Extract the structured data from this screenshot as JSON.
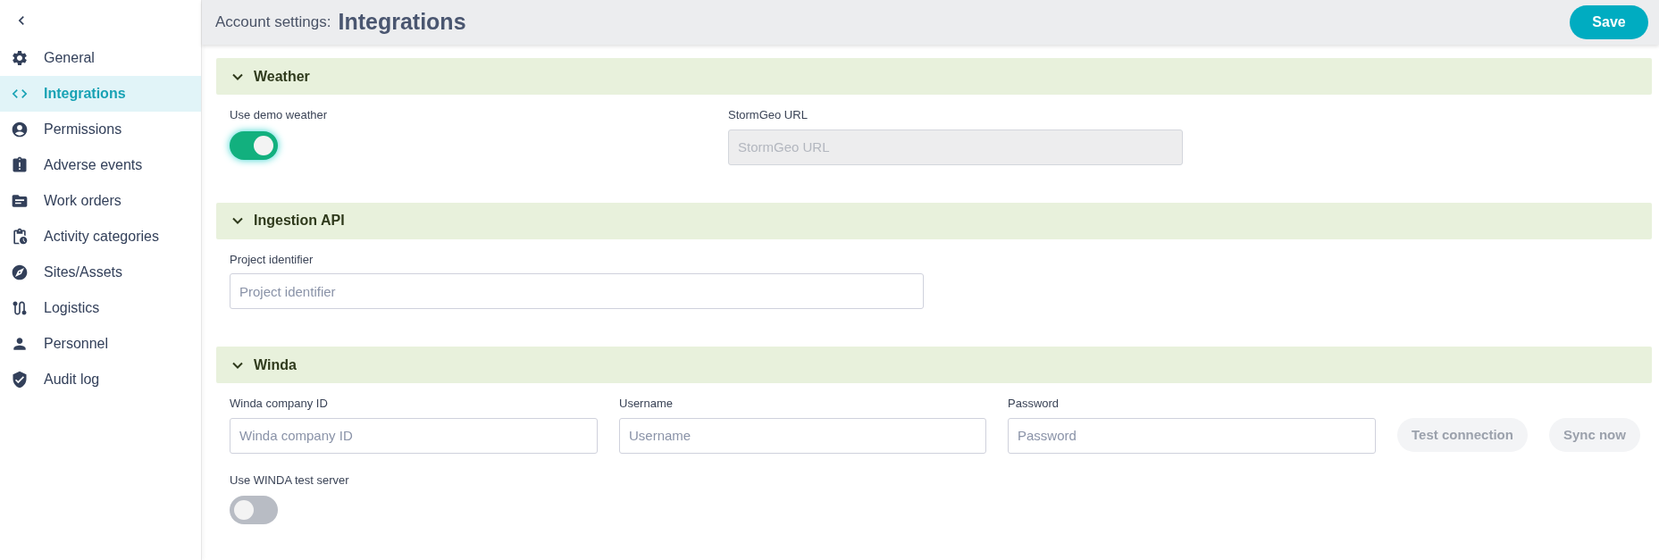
{
  "sidebar": {
    "items": [
      {
        "label": "General",
        "selected": false
      },
      {
        "label": "Integrations",
        "selected": true
      },
      {
        "label": "Permissions",
        "selected": false
      },
      {
        "label": "Adverse events",
        "selected": false
      },
      {
        "label": "Work orders",
        "selected": false
      },
      {
        "label": "Activity categories",
        "selected": false
      },
      {
        "label": "Sites/Assets",
        "selected": false
      },
      {
        "label": "Logistics",
        "selected": false
      },
      {
        "label": "Personnel",
        "selected": false
      },
      {
        "label": "Audit log",
        "selected": false
      }
    ]
  },
  "header": {
    "prefix": "Account settings:",
    "title": "Integrations",
    "save_button": "Save"
  },
  "sections": [
    {
      "title": "Weather",
      "expanded": true,
      "rows": [
        [
          {
            "kind": "toggle",
            "label": "Use demo weather",
            "on": true
          },
          {
            "kind": "input",
            "label": "StormGeo URL",
            "placeholder": "StormGeo URL",
            "disabled": true
          }
        ]
      ]
    },
    {
      "title": "Ingestion API",
      "expanded": true,
      "rows": [
        [
          {
            "kind": "input",
            "label": "Project identifier",
            "placeholder": "Project identifier",
            "disabled": false
          }
        ]
      ]
    },
    {
      "title": "Winda",
      "expanded": true,
      "rows": [
        [
          {
            "kind": "input",
            "label": "Winda company ID",
            "placeholder": "Winda company ID",
            "disabled": false
          },
          {
            "kind": "input",
            "label": "Username",
            "placeholder": "Username",
            "disabled": false
          },
          {
            "kind": "input",
            "label": "Password",
            "placeholder": "Password",
            "disabled": false
          },
          {
            "kind": "button",
            "label": "Test connection",
            "disabled": true
          },
          {
            "kind": "button",
            "label": "Sync now",
            "disabled": true
          }
        ],
        [
          {
            "kind": "toggle",
            "label": "Use WINDA test server",
            "on": false
          }
        ]
      ]
    }
  ]
}
